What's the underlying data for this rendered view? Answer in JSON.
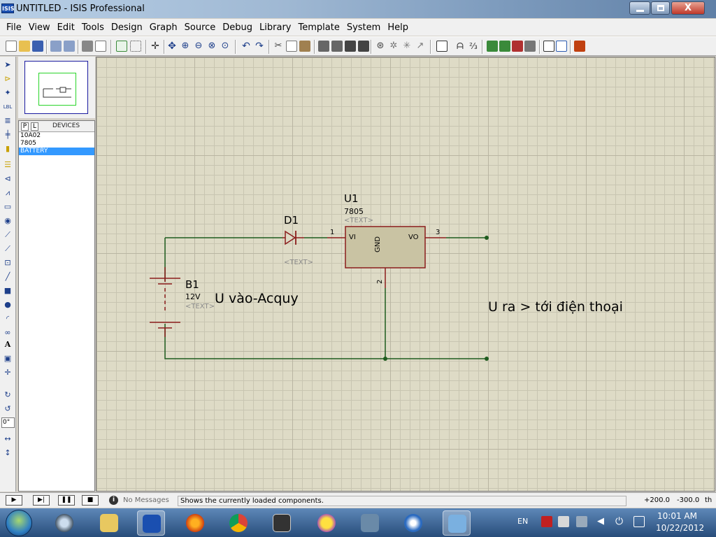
{
  "window": {
    "app_icon": "ISIS",
    "title": "UNTITLED - ISIS Professional",
    "close_glyph": "X"
  },
  "menu": [
    "File",
    "View",
    "Edit",
    "Tools",
    "Design",
    "Graph",
    "Source",
    "Debug",
    "Library",
    "Template",
    "System",
    "Help"
  ],
  "left_panel": {
    "tab_p": "P",
    "tab_l": "L",
    "title": "DEVICES",
    "devices": [
      "10A02",
      "7805",
      "BATTERY"
    ],
    "selected_device": "BATTERY",
    "angle": "0°"
  },
  "schematic": {
    "d1": {
      "ref": "D1",
      "text": "<TEXT>"
    },
    "u1": {
      "ref": "U1",
      "value": "7805",
      "text": "<TEXT>",
      "pin_vi": "VI",
      "pin_vo": "VO",
      "pin_gnd": "GND",
      "pin1": "1",
      "pin2": "2",
      "pin3": "3"
    },
    "b1": {
      "ref": "B1",
      "value": "12V",
      "text": "<TEXT>"
    },
    "annotation_in": "U vào-Acquy",
    "annotation_out": "U ra > tới điện thoại",
    "colors": {
      "wire": "#1f5c1f",
      "component": "#8b1c1c",
      "ic_fill": "#c9c3a3",
      "grid": "#dedbc6"
    }
  },
  "status": {
    "messages": "No Messages",
    "info_icon": "i",
    "hint": "Shows the currently loaded components.",
    "coord_x": "+200.0",
    "coord_y": "-300.0",
    "units": "th"
  },
  "taskbar": {
    "language": "EN",
    "time": "10:01 AM",
    "date": "10/22/2012"
  }
}
